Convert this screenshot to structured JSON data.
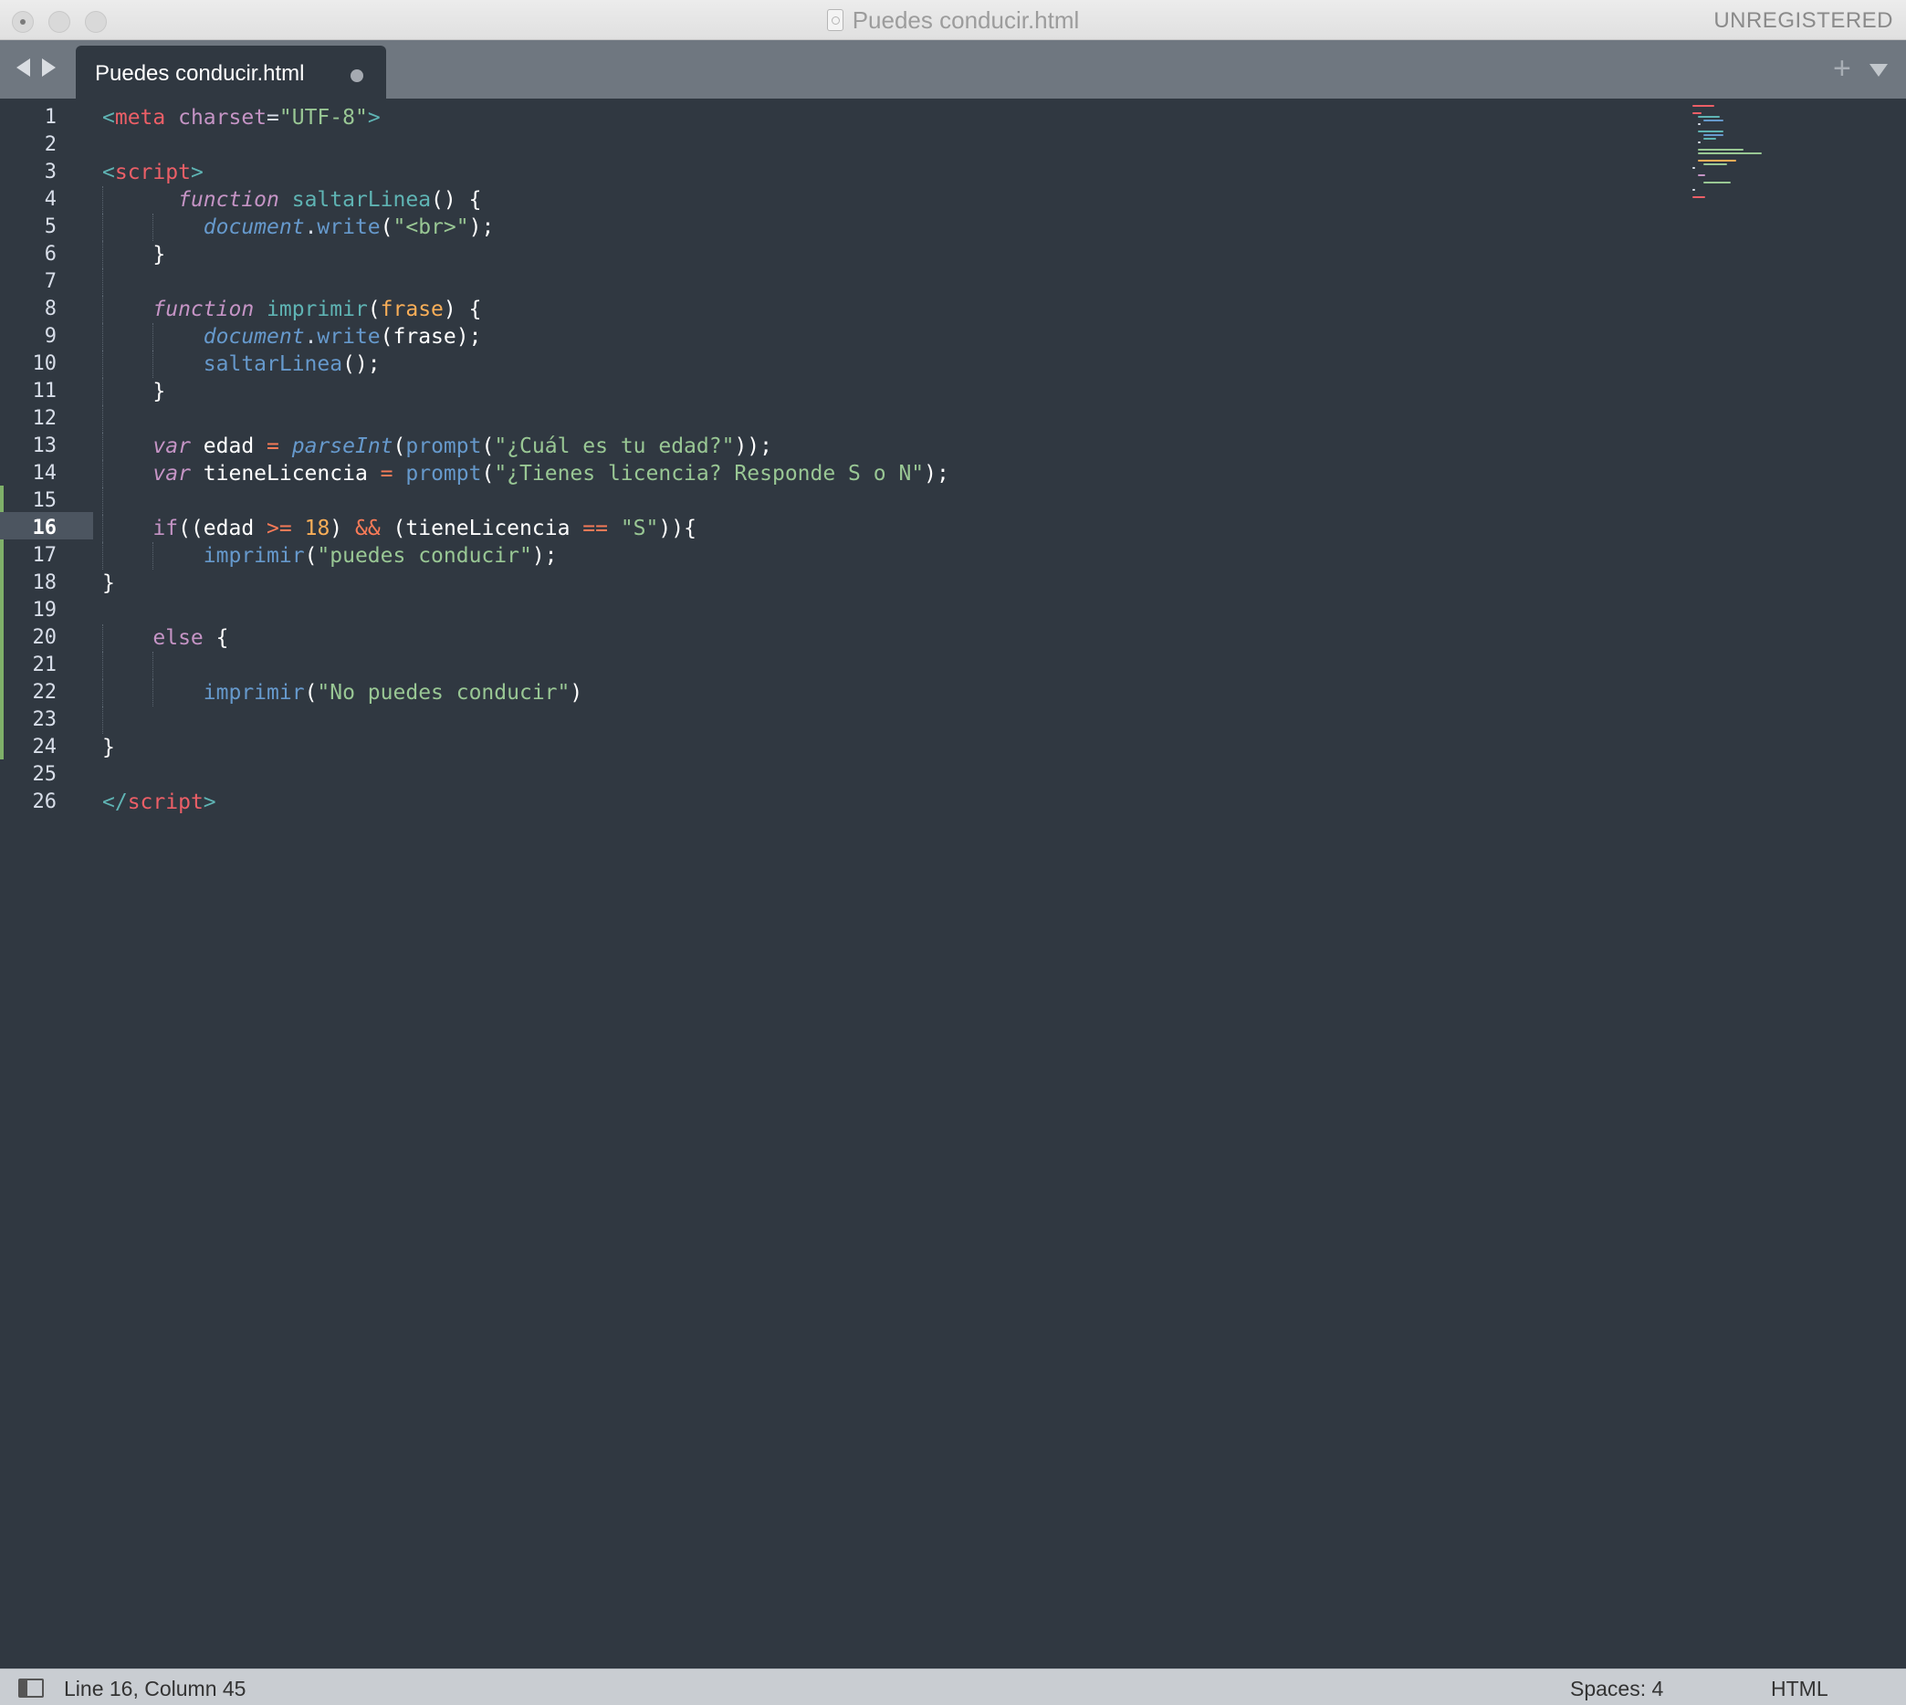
{
  "window": {
    "title": "Puedes conducir.html",
    "license_status": "UNREGISTERED"
  },
  "tabs": [
    {
      "label": "Puedes conducir.html",
      "modified": true,
      "active": true
    }
  ],
  "editor": {
    "current_line": 16,
    "line_numbers": [
      "1",
      "2",
      "3",
      "4",
      "5",
      "6",
      "7",
      "8",
      "9",
      "10",
      "11",
      "12",
      "13",
      "14",
      "15",
      "16",
      "17",
      "18",
      "19",
      "20",
      "21",
      "22",
      "23",
      "24",
      "25",
      "26"
    ],
    "code": {
      "l1": {
        "lt": "<",
        "tag": "meta",
        "attr": " charset",
        "eq": "=",
        "val": "\"UTF-8\"",
        "gt": ">"
      },
      "l3": {
        "lt": "<",
        "tag": "script",
        "gt": ">"
      },
      "l4": {
        "kw": "function",
        "name": " saltarLinea",
        "rest": "() {"
      },
      "l5": {
        "obj": "document",
        "dot": ".",
        "call": "write",
        "open": "(",
        "str": "\"<br>\"",
        "close": ");"
      },
      "l6": {
        "rest": "}"
      },
      "l8": {
        "kw": "function",
        "name": " imprimir",
        "open": "(",
        "param": "frase",
        "close": ") {"
      },
      "l9": {
        "obj": "document",
        "dot": ".",
        "call": "write",
        "rest": "(frase);"
      },
      "l10": {
        "call": "saltarLinea",
        "rest": "();"
      },
      "l11": {
        "rest": "}"
      },
      "l13": {
        "kw": "var",
        "ident": " edad ",
        "op": "=",
        "sp": " ",
        "lib": "parseInt",
        "open": "(",
        "call": "prompt",
        "open2": "(",
        "str": "\"¿Cuál es tu edad?\"",
        "close": "));"
      },
      "l14": {
        "kw": "var",
        "ident": " tieneLicencia ",
        "op": "=",
        "sp": " ",
        "call": "prompt",
        "open": "(",
        "str": "\"¿Tienes licencia? Responde S o N\"",
        "close": ");"
      },
      "l16": {
        "kw": "if",
        "p1": "((edad ",
        "op1": ">=",
        "sp1": " ",
        "num": "18",
        "p2": ") ",
        "op2": "&&",
        "p3": " (tieneLicencia ",
        "op3": "==",
        "sp3": " ",
        "str": "\"S\"",
        "close": ")){"
      },
      "l17": {
        "call": "imprimir",
        "open": "(",
        "str": "\"puedes conducir\"",
        "close": ");"
      },
      "l18": {
        "rest": "}"
      },
      "l20": {
        "kw": "else",
        "rest": " {"
      },
      "l22": {
        "call": "imprimir",
        "open": "(",
        "str": "\"No puedes conducir\"",
        "close": ")"
      },
      "l24": {
        "rest": "}"
      },
      "l26": {
        "lt": "</",
        "tag": "script",
        "gt": ">"
      }
    }
  },
  "statusbar": {
    "position": "Line 16, Column 45",
    "indentation": "Spaces: 4",
    "syntax": "HTML"
  },
  "colors": {
    "editor_bg": "#303841",
    "tab_bar_bg": "#6f7780",
    "status_bar_bg": "#c9cdd2",
    "modified_marker": "#7fb069"
  }
}
